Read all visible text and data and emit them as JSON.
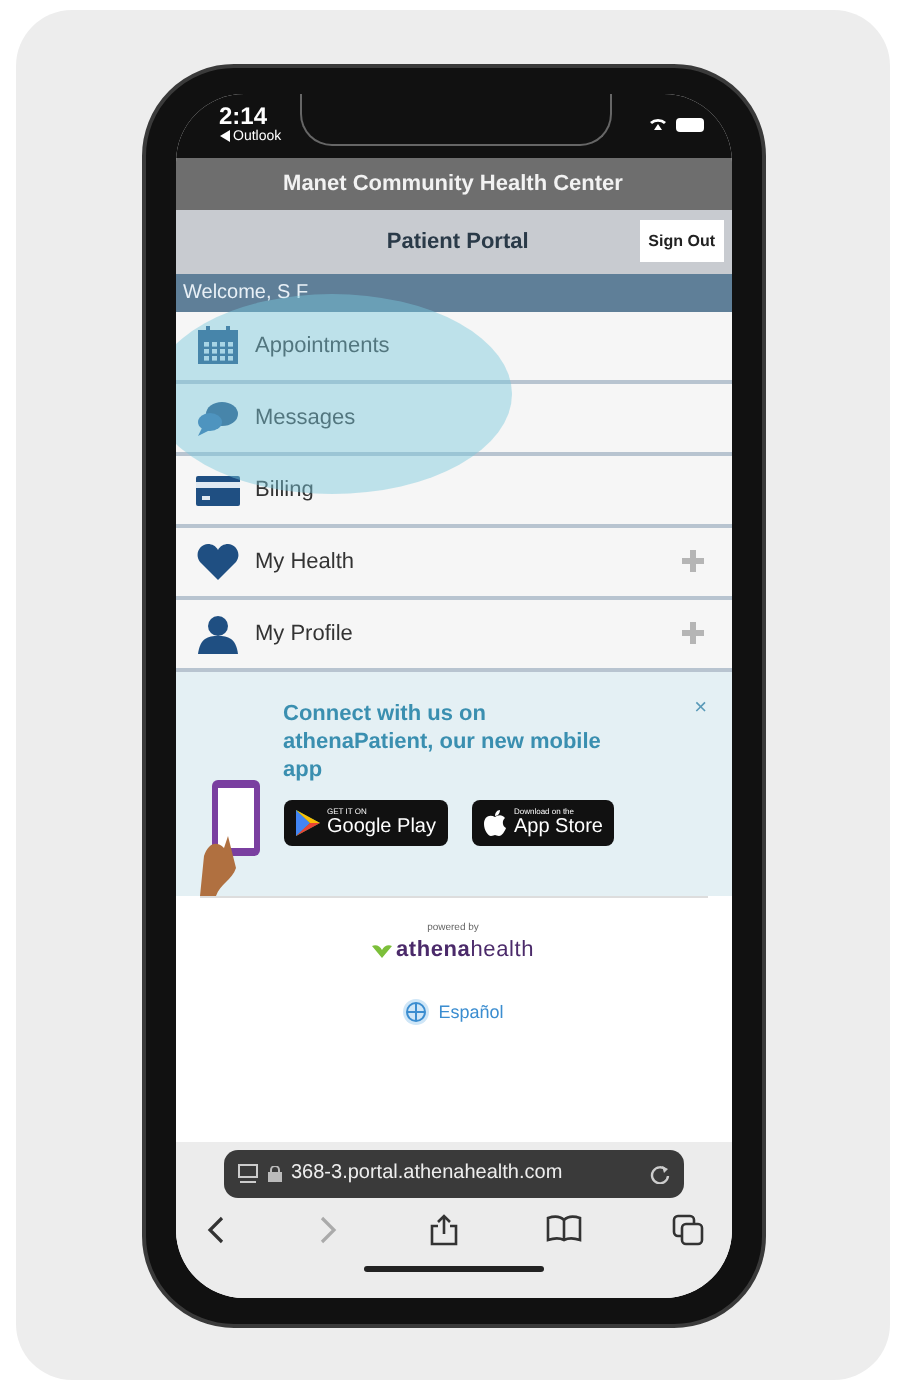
{
  "status_bar": {
    "time": "2:14",
    "back_app": "Outlook"
  },
  "header": {
    "title": "Manet Community Health Center"
  },
  "portal_bar": {
    "title": "Patient Portal",
    "sign_out": "Sign Out"
  },
  "welcome": "Welcome, S F",
  "menu": [
    {
      "label": "Appointments",
      "kind": "calendar",
      "expandable": false
    },
    {
      "label": "Messages",
      "kind": "chat",
      "expandable": false
    },
    {
      "label": "Billing",
      "kind": "card",
      "expandable": false
    },
    {
      "label": "My Health",
      "kind": "heart",
      "expandable": true
    },
    {
      "label": "My Profile",
      "kind": "person",
      "expandable": true
    }
  ],
  "banner": {
    "text": "Connect with us on athenaPatient, our new mobile app",
    "close": "×",
    "badges": [
      {
        "kind": "google",
        "small": "GET IT ON",
        "big": "Google Play"
      },
      {
        "kind": "apple",
        "small": "Download on the",
        "big": "App Store"
      }
    ]
  },
  "footer": {
    "powered_by": "powered by",
    "brand": "**athena**health",
    "language": "Español"
  },
  "browser": {
    "url": "368-3.portal.athenahealth.com"
  }
}
